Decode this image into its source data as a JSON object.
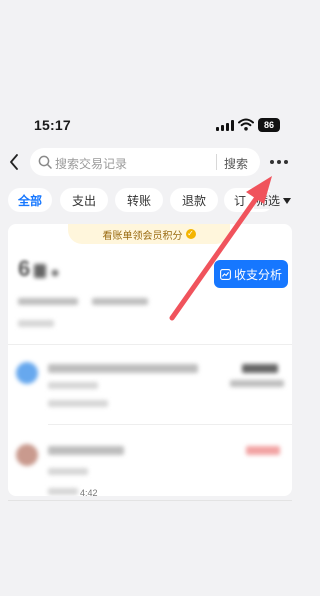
{
  "status_bar": {
    "time": "15:17",
    "battery": "86"
  },
  "search": {
    "placeholder": "搜索交易记录",
    "button": "搜索"
  },
  "tabs": [
    {
      "label": "全部",
      "active": true
    },
    {
      "label": "支出"
    },
    {
      "label": "转账"
    },
    {
      "label": "退款"
    },
    {
      "label": "订"
    }
  ],
  "filter": {
    "label": "筛选"
  },
  "promo": {
    "text": "看账单领会员积分"
  },
  "analysis_button": {
    "label": "收支分析"
  },
  "summary": {
    "title_partial": "6"
  },
  "transactions": [
    {
      "time_partial": "4:42"
    }
  ],
  "colors": {
    "accent": "#1677ff",
    "arrow": "#f0535c",
    "promo_bg": "#fff6dc"
  }
}
